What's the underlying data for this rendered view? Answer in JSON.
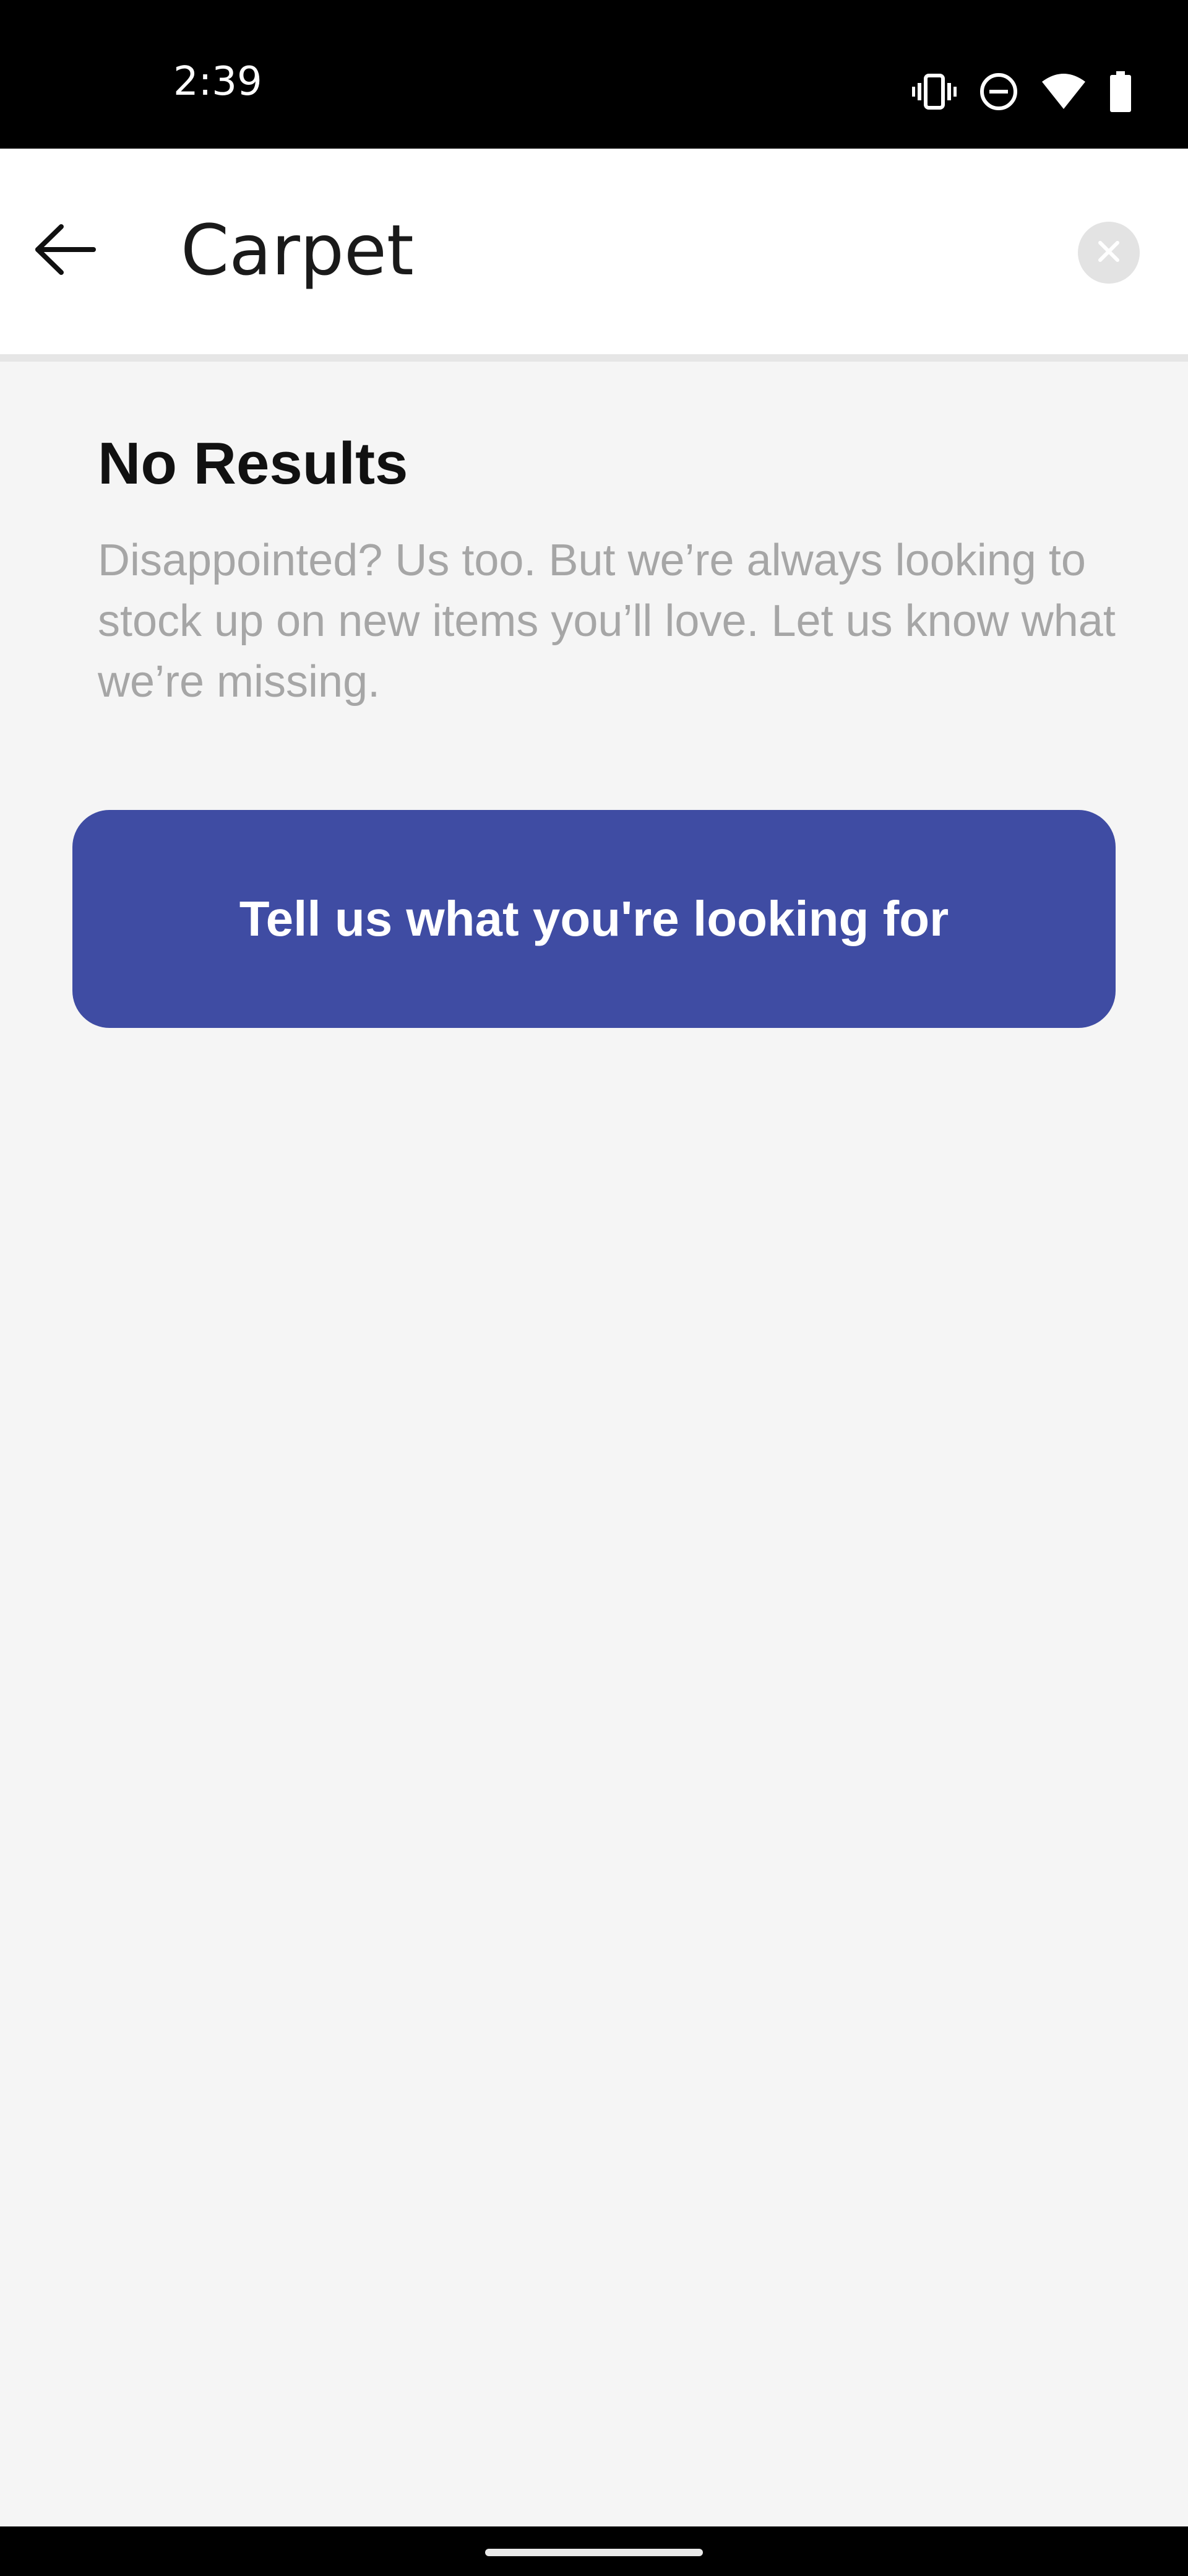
{
  "status_bar": {
    "time": "2:39",
    "icons": [
      "vibrate-icon",
      "do-not-disturb-icon",
      "wifi-icon",
      "battery-icon"
    ]
  },
  "search": {
    "query": "Carpet",
    "back_icon": "arrow-left-icon",
    "clear_icon": "close-icon"
  },
  "results": {
    "title": "No Results",
    "message": "Disappointed? Us too. But we’re always looking to stock up on new items you’ll love. Let us know what we’re missing.",
    "cta_label": "Tell us what you're looking for"
  },
  "colors": {
    "accent": "#3f4ca3",
    "background": "#f5f5f5",
    "muted_text": "#a6a6a6"
  }
}
